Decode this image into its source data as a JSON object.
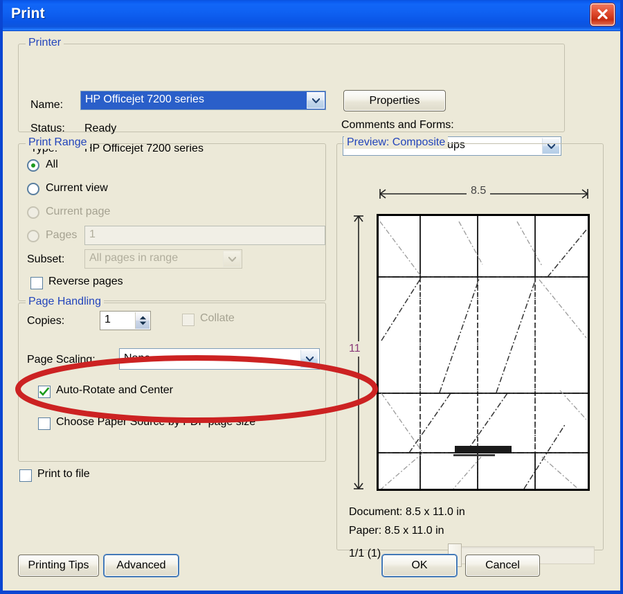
{
  "window": {
    "title": "Print",
    "close_icon": "close-x-icon"
  },
  "printer": {
    "legend": "Printer",
    "name_label": "Name:",
    "name_value": "HP Officejet 7200 series",
    "status_label": "Status:",
    "status_value": "Ready",
    "type_label": "Type:",
    "type_value": "HP Officejet 7200 series",
    "properties_button": "Properties",
    "comments_label": "Comments and Forms:",
    "comments_value": "Document and Markups"
  },
  "print_range": {
    "legend": "Print Range",
    "options": [
      {
        "label": "All",
        "selected": true,
        "enabled": true
      },
      {
        "label": "Current view",
        "selected": false,
        "enabled": true
      },
      {
        "label": "Current page",
        "selected": false,
        "enabled": false
      },
      {
        "label": "Pages",
        "selected": false,
        "enabled": false
      }
    ],
    "pages_value": "1",
    "subset_label": "Subset:",
    "subset_value": "All pages in range",
    "reverse_label": "Reverse pages",
    "reverse_checked": false
  },
  "page_handling": {
    "legend": "Page Handling",
    "copies_label": "Copies:",
    "copies_value": "1",
    "collate_label": "Collate",
    "collate_checked": false,
    "collate_enabled": false,
    "scaling_label": "Page Scaling:",
    "scaling_value": "None",
    "autorotate_label": "Auto-Rotate and Center",
    "autorotate_checked": true,
    "papersource_label": "Choose Paper Source by PDF page size",
    "papersource_checked": false
  },
  "print_to_file": {
    "label": "Print to file",
    "checked": false
  },
  "preview": {
    "legend": "Preview: Composite",
    "width_dim": "8.5",
    "height_dim": "11",
    "document_info": "Document: 8.5 x 11.0 in",
    "paper_info": "Paper: 8.5 x 11.0 in",
    "page_counter": "1/1 (1)"
  },
  "buttons": {
    "printing_tips": "Printing Tips",
    "advanced": "Advanced",
    "ok": "OK",
    "cancel": "Cancel"
  },
  "annotation": {
    "shape": "ellipse-highlight",
    "color": "#cc2222",
    "target": "Page Scaling"
  },
  "colors": {
    "titlebar_blue": "#0d5ae8",
    "dialog_face": "#ece9d8",
    "group_legend": "#2244bb",
    "selection_blue": "#2a5fc9",
    "annotation_red": "#cc2222",
    "dim_purple": "#8a3a7a"
  }
}
